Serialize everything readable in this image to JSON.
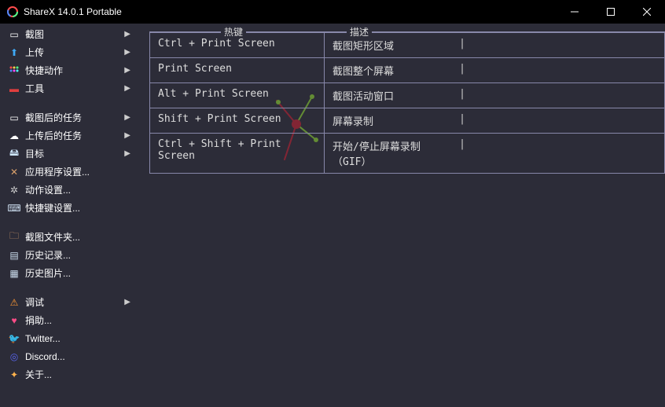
{
  "window": {
    "title": "ShareX 14.0.1 Portable"
  },
  "sidebar": {
    "groups": [
      [
        {
          "icon": "camera-icon",
          "color": "#fff",
          "glyph": "▭",
          "label": "截图",
          "sub": true
        },
        {
          "icon": "upload-icon",
          "color": "#3fa9f5",
          "glyph": "⬆",
          "label": "上传",
          "sub": true
        },
        {
          "icon": "actions-icon",
          "color": "",
          "glyph": "",
          "svg": "dots",
          "label": "快捷动作",
          "sub": true
        },
        {
          "icon": "tools-icon",
          "color": "#e03e3e",
          "glyph": "▬",
          "label": "工具",
          "sub": true
        }
      ],
      [
        {
          "icon": "after-capture-icon",
          "color": "#fff",
          "glyph": "▭",
          "label": "截图后的任务",
          "sub": true
        },
        {
          "icon": "after-upload-icon",
          "color": "#fff",
          "glyph": "☁",
          "label": "上传后的任务",
          "sub": true
        },
        {
          "icon": "destinations-icon",
          "color": "#cfe8ff",
          "glyph": "🖴",
          "label": "目标",
          "sub": true
        },
        {
          "icon": "app-settings-icon",
          "color": "#d9a06b",
          "glyph": "✕",
          "label": "应用程序设置...",
          "sub": false
        },
        {
          "icon": "task-settings-icon",
          "color": "#ccc",
          "glyph": "✲",
          "label": "动作设置...",
          "sub": false
        },
        {
          "icon": "hotkey-settings-icon",
          "color": "#cde",
          "glyph": "⌨",
          "label": "快捷键设置...",
          "sub": false
        }
      ],
      [
        {
          "icon": "folder-icon",
          "color": "#d9a06b",
          "glyph": "🗀",
          "label": "截图文件夹...",
          "sub": false
        },
        {
          "icon": "history-icon",
          "color": "#cde",
          "glyph": "▤",
          "label": "历史记录...",
          "sub": false
        },
        {
          "icon": "image-history-icon",
          "color": "#cde",
          "glyph": "▦",
          "label": "历史图片...",
          "sub": false
        }
      ],
      [
        {
          "icon": "debug-icon",
          "color": "#ff9933",
          "glyph": "⚠",
          "label": "调试",
          "sub": true
        },
        {
          "icon": "donate-icon",
          "color": "#ff4d88",
          "glyph": "♥",
          "label": "捐助...",
          "sub": false
        },
        {
          "icon": "twitter-icon",
          "color": "#3fa9f5",
          "glyph": "🐦",
          "label": "Twitter...",
          "sub": false
        },
        {
          "icon": "discord-icon",
          "color": "#5865f2",
          "glyph": "◎",
          "label": "Discord...",
          "sub": false
        },
        {
          "icon": "about-icon",
          "color": "#ffb34d",
          "glyph": "✦",
          "label": "关于...",
          "sub": false
        }
      ]
    ]
  },
  "hotkeys": {
    "header_key": "热键",
    "header_desc": "描述",
    "rows": [
      {
        "key": "Ctrl + Print Screen",
        "desc": "截图矩形区域"
      },
      {
        "key": "Print Screen",
        "desc": "截图整个屏幕"
      },
      {
        "key": "Alt + Print Screen",
        "desc": "截图活动窗口"
      },
      {
        "key": "Shift + Print Screen",
        "desc": "屏幕录制"
      },
      {
        "key": "Ctrl + Shift + Print Screen",
        "desc": "开始/停止屏幕录制（GIF）"
      }
    ]
  }
}
